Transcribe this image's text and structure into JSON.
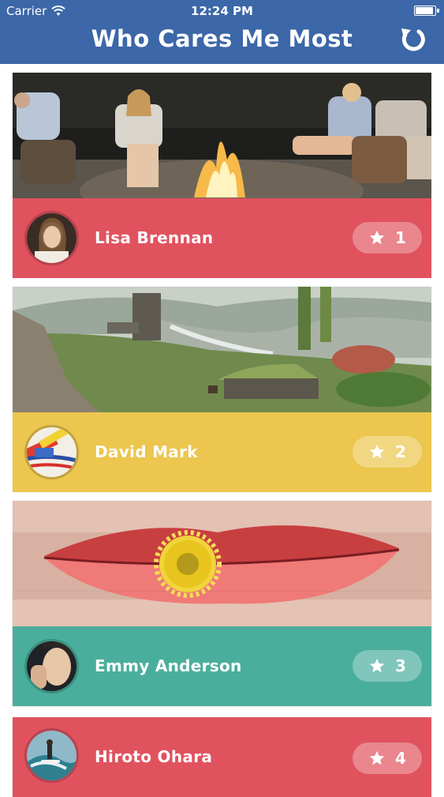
{
  "status_bar": {
    "carrier": "Carrier",
    "time": "12:24 PM"
  },
  "nav": {
    "title": "Who Cares Me Most",
    "refresh_icon": "refresh-icon"
  },
  "colors": {
    "nav": "#3c67a8",
    "red": "#e0525e",
    "yellow": "#ecc64e",
    "teal": "#4aae9c"
  },
  "cards": [
    {
      "name": "Lisa Brennan",
      "rank": "1",
      "bar_color": "#e0525e",
      "photo": "campfire at night",
      "avatar": "young woman portrait"
    },
    {
      "name": "David Mark",
      "rank": "2",
      "bar_color": "#ecc64e",
      "photo": "valley with stone tower and cottage",
      "avatar": "paint tubes"
    },
    {
      "name": "Emmy Anderson",
      "rank": "3",
      "bar_color": "#4aae9c",
      "photo": "lips holding yellow flower",
      "avatar": "woman face"
    },
    {
      "name": "Hiroto Ohara",
      "rank": "4",
      "bar_color": "#e0525e",
      "photo": "",
      "avatar": "surfer on wave"
    }
  ]
}
